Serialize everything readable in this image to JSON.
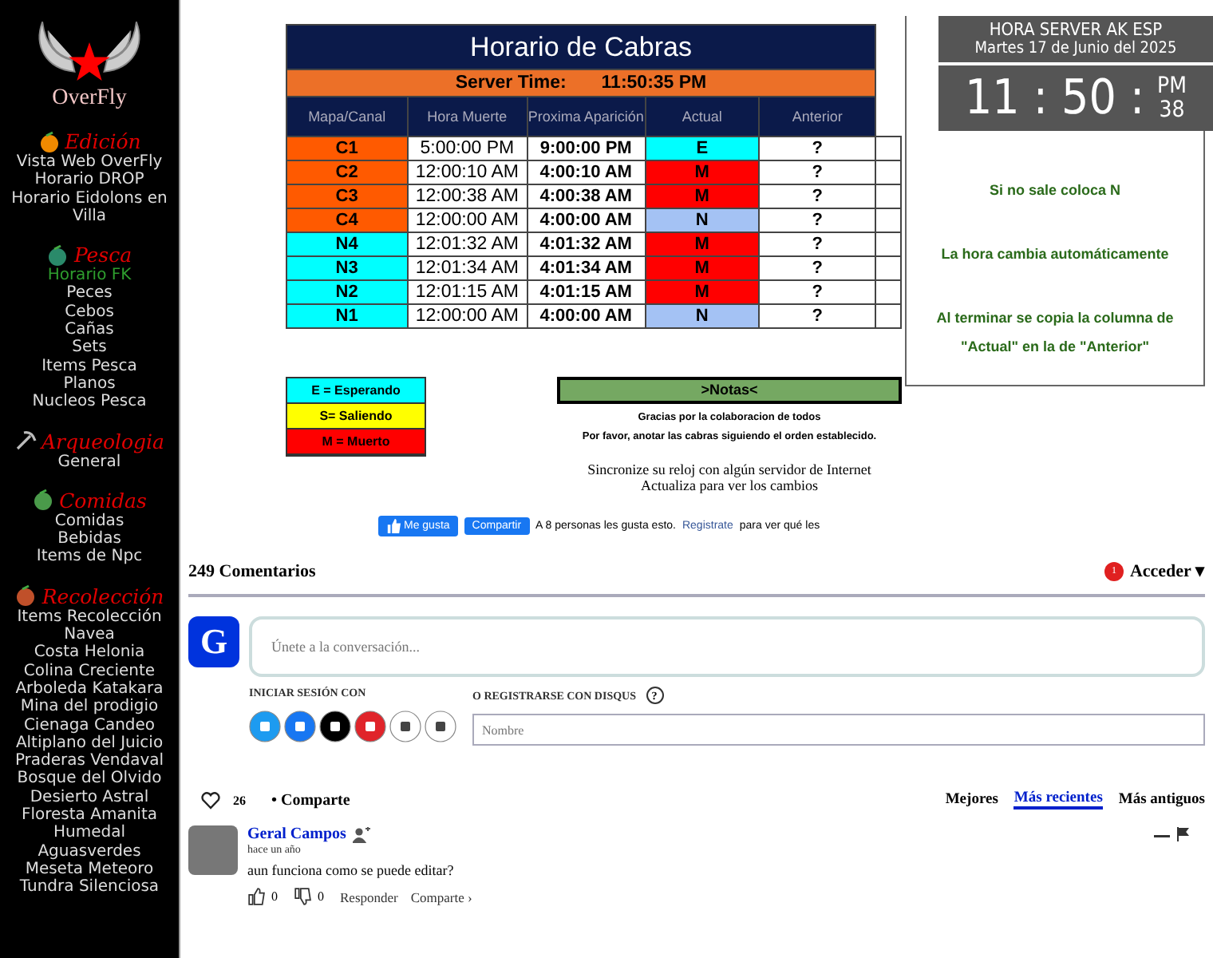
{
  "sidebar": {
    "logo_text": "OverFly",
    "sections": [
      {
        "title": "Edición",
        "items": [
          {
            "label": "Vista Web OverFly",
            "selected": false
          },
          {
            "label": "Horario DROP",
            "selected": false
          },
          {
            "label": "Horario Eidolons en Villa",
            "selected": false
          }
        ]
      },
      {
        "title": "Pesca",
        "items": [
          {
            "label": "Horario FK",
            "selected": true
          },
          {
            "label": "Peces",
            "selected": false
          },
          {
            "label": "Cebos",
            "selected": false
          },
          {
            "label": "Cañas",
            "selected": false
          },
          {
            "label": "Sets",
            "selected": false
          },
          {
            "label": "Items Pesca",
            "selected": false
          },
          {
            "label": "Planos",
            "selected": false
          },
          {
            "label": "Nucleos Pesca",
            "selected": false
          }
        ]
      },
      {
        "title": "Arqueologia",
        "items": [
          {
            "label": "General",
            "selected": false
          }
        ]
      },
      {
        "title": "Comidas",
        "items": [
          {
            "label": "Comidas",
            "selected": false
          },
          {
            "label": "Bebidas",
            "selected": false
          },
          {
            "label": "Items de Npc",
            "selected": false
          }
        ]
      },
      {
        "title": "Recolección",
        "items": [
          {
            "label": "Items Recolección",
            "selected": false
          },
          {
            "label": "Navea",
            "selected": false
          },
          {
            "label": "Costa Helonia",
            "selected": false
          },
          {
            "label": "Colina Creciente",
            "selected": false
          },
          {
            "label": "Arboleda Katakara",
            "selected": false
          },
          {
            "label": "Mina del prodigio",
            "selected": false
          },
          {
            "label": "Cienaga Candeo",
            "selected": false
          },
          {
            "label": "Altiplano del Juicio",
            "selected": false
          },
          {
            "label": "Praderas Vendaval",
            "selected": false
          },
          {
            "label": "Bosque del Olvido",
            "selected": false
          },
          {
            "label": "Desierto Astral",
            "selected": false
          },
          {
            "label": "Floresta Amanita",
            "selected": false
          },
          {
            "label": "Humedal",
            "selected": false
          },
          {
            "label": "Aguasverdes",
            "selected": false
          },
          {
            "label": "Meseta Meteoro",
            "selected": false
          },
          {
            "label": "Tundra Silenciosa",
            "selected": false
          }
        ]
      }
    ]
  },
  "schedule": {
    "title": "Horario de Cabras",
    "server_label": "Server Time:",
    "server_time": "11:50:35 PM",
    "columns": [
      "Mapa/Canal",
      "Hora Muerte",
      "Proxima Aparición",
      "Actual",
      "Anterior"
    ],
    "rows": [
      {
        "map": "C1",
        "color": "#ff5a00",
        "death": "5:00:00 PM",
        "next": "9:00:00 PM",
        "actual": {
          "label": "E",
          "color": "#00ffff"
        },
        "previous": "?"
      },
      {
        "map": "C2",
        "color": "#ff5a00",
        "death": "12:00:10 AM",
        "next": "4:00:10 AM",
        "actual": {
          "label": "M",
          "color": "#ff0000"
        },
        "previous": "?"
      },
      {
        "map": "C3",
        "color": "#ff5a00",
        "death": "12:00:38 AM",
        "next": "4:00:38 AM",
        "actual": {
          "label": "M",
          "color": "#ff0000"
        },
        "previous": "?"
      },
      {
        "map": "C4",
        "color": "#ff5a00",
        "death": "12:00:00 AM",
        "next": "4:00:00 AM",
        "actual": {
          "label": "N",
          "color": "#a4c2f4"
        },
        "previous": "?"
      },
      {
        "map": "N4",
        "color": "#00ffff",
        "death": "12:01:32 AM",
        "next": "4:01:32 AM",
        "actual": {
          "label": "M",
          "color": "#ff0000"
        },
        "previous": "?"
      },
      {
        "map": "N3",
        "color": "#00ffff",
        "death": "12:01:34 AM",
        "next": "4:01:34 AM",
        "actual": {
          "label": "M",
          "color": "#ff0000"
        },
        "previous": "?"
      },
      {
        "map": "N2",
        "color": "#00ffff",
        "death": "12:01:15 AM",
        "next": "4:01:15 AM",
        "actual": {
          "label": "M",
          "color": "#ff0000"
        },
        "previous": "?"
      },
      {
        "map": "N1",
        "color": "#00ffff",
        "death": "12:00:00 AM",
        "next": "4:00:00 AM",
        "actual": {
          "label": "N",
          "color": "#a4c2f4"
        },
        "previous": "?"
      }
    ]
  },
  "legend": [
    {
      "label": "E = Esperando",
      "color": "#00ffff"
    },
    {
      "label": "S= Saliendo",
      "color": "#ffff00"
    },
    {
      "label": "M = Muerto",
      "color": "#ff0000"
    }
  ],
  "notes": {
    "title": ">Notas<",
    "lines": [
      "Gracias por la colaboracion de todos",
      "Por favor, anotar las cabras siguiendo el orden establecido."
    ]
  },
  "sync_lines": [
    "Sincronize su reloj con algún servidor de Internet",
    "Actualiza para ver los cambios"
  ],
  "facebook": {
    "like": "Me gusta",
    "share": "Compartir",
    "text_before": "A 8 personas les gusta esto.",
    "link": "Registrate",
    "text_after": "para ver qué les"
  },
  "instructions": [
    "Si no sale coloca N",
    "La hora cambia automáticamente",
    "Al terminar se copia la columna de \"Actual\" en la de \"Anterior\""
  ],
  "clock": {
    "title": "HORA SERVER AK ESP",
    "date": "Martes 17 de Junio del 2025",
    "time": "11 : 50 :",
    "ampm": "PM",
    "seconds": "38"
  },
  "comments": {
    "count": "249 Comentarios",
    "notifications": "1",
    "login": "Acceder ▾",
    "avatar_letter": "G",
    "placeholder": "Únete a la conversación...",
    "login_with": "INICIAR SESIÓN CON",
    "register_with": "O REGISTRARSE CON DISQUS",
    "help": "?",
    "name_placeholder": "Nombre",
    "likes": "26",
    "share": "• Comparte",
    "sort": [
      {
        "label": "Mejores",
        "selected": false
      },
      {
        "label": "Más recientes",
        "selected": true
      },
      {
        "label": "Más antiguos",
        "selected": false
      }
    ],
    "items": [
      {
        "author": "Geral Campos",
        "time": "hace un año",
        "text": "aun funciona como se puede editar?",
        "upvotes": "0",
        "downvotes": "0",
        "reply": "Responder",
        "share": "Comparte ›"
      }
    ]
  }
}
